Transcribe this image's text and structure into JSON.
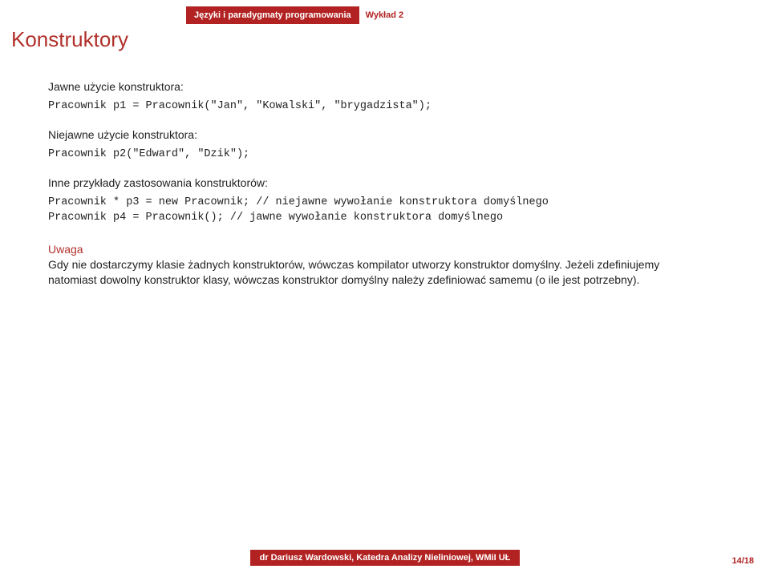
{
  "header": {
    "course": "Języki i paradygmaty programowania",
    "lecture": "Wykład 2"
  },
  "title": "Konstruktory",
  "sections": {
    "explicit_label": "Jawne użycie konstruktora:",
    "explicit_code": "Pracownik p1 = Pracownik(\"Jan\", \"Kowalski\", \"brygadzista\");",
    "implicit_label": "Niejawne użycie konstruktora:",
    "implicit_code": "Pracownik p2(\"Edward\", \"Dzik\");",
    "other_label": "Inne przykłady zastosowania konstruktorów:",
    "other_code": "Pracownik * p3 = new Pracownik; // niejawne wywołanie konstruktora domyślnego\nPracownik p4 = Pracownik(); // jawne wywołanie konstruktora domyślnego"
  },
  "note": {
    "title": "Uwaga",
    "body": "Gdy nie dostarczymy klasie żadnych konstruktorów, wówczas kompilator utworzy konstruktor domyślny. Jeżeli zdefiniujemy natomiast dowolny konstruktor klasy, wówczas konstruktor domyślny należy zdefiniować samemu (o ile jest potrzebny)."
  },
  "footer": {
    "author": "dr Dariusz Wardowski, Katedra Analizy Nieliniowej, WMiI UŁ",
    "page": "14/18"
  }
}
